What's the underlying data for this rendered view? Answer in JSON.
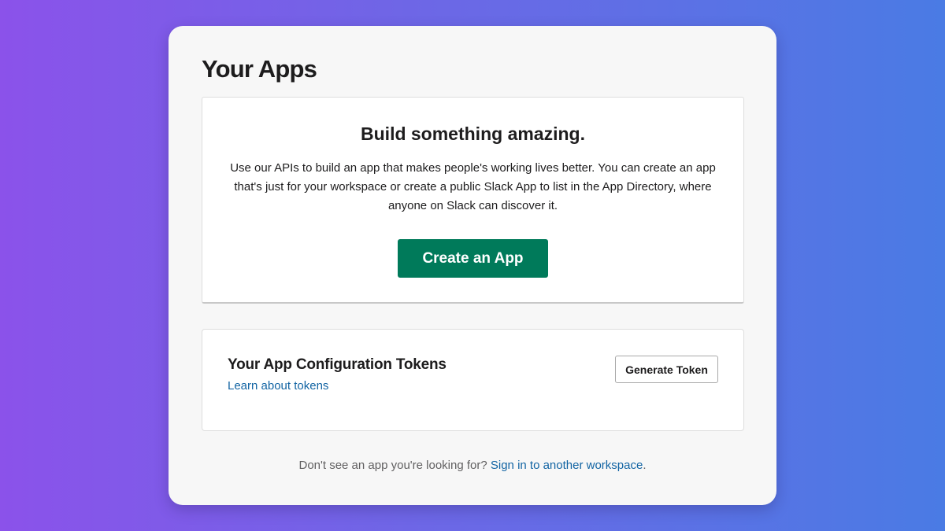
{
  "page": {
    "title": "Your Apps"
  },
  "hero": {
    "heading": "Build something amazing.",
    "description": "Use our APIs to build an app that makes people's working lives better. You can create an app that's just for your workspace or create a public Slack App to list in the App Directory, where anyone on Slack can discover it.",
    "create_button_label": "Create an App"
  },
  "tokens": {
    "title": "Your App Configuration Tokens",
    "learn_link": "Learn about tokens",
    "generate_button_label": "Generate Token"
  },
  "footer": {
    "prompt": "Don't see an app you're looking for? ",
    "link": "Sign in to another workspace",
    "suffix": "."
  },
  "colors": {
    "primary_button": "#007a5a",
    "link": "#1264a3",
    "panel_background": "#f7f7f7",
    "gradient_start": "#8b52ea",
    "gradient_end": "#4a7be4"
  }
}
